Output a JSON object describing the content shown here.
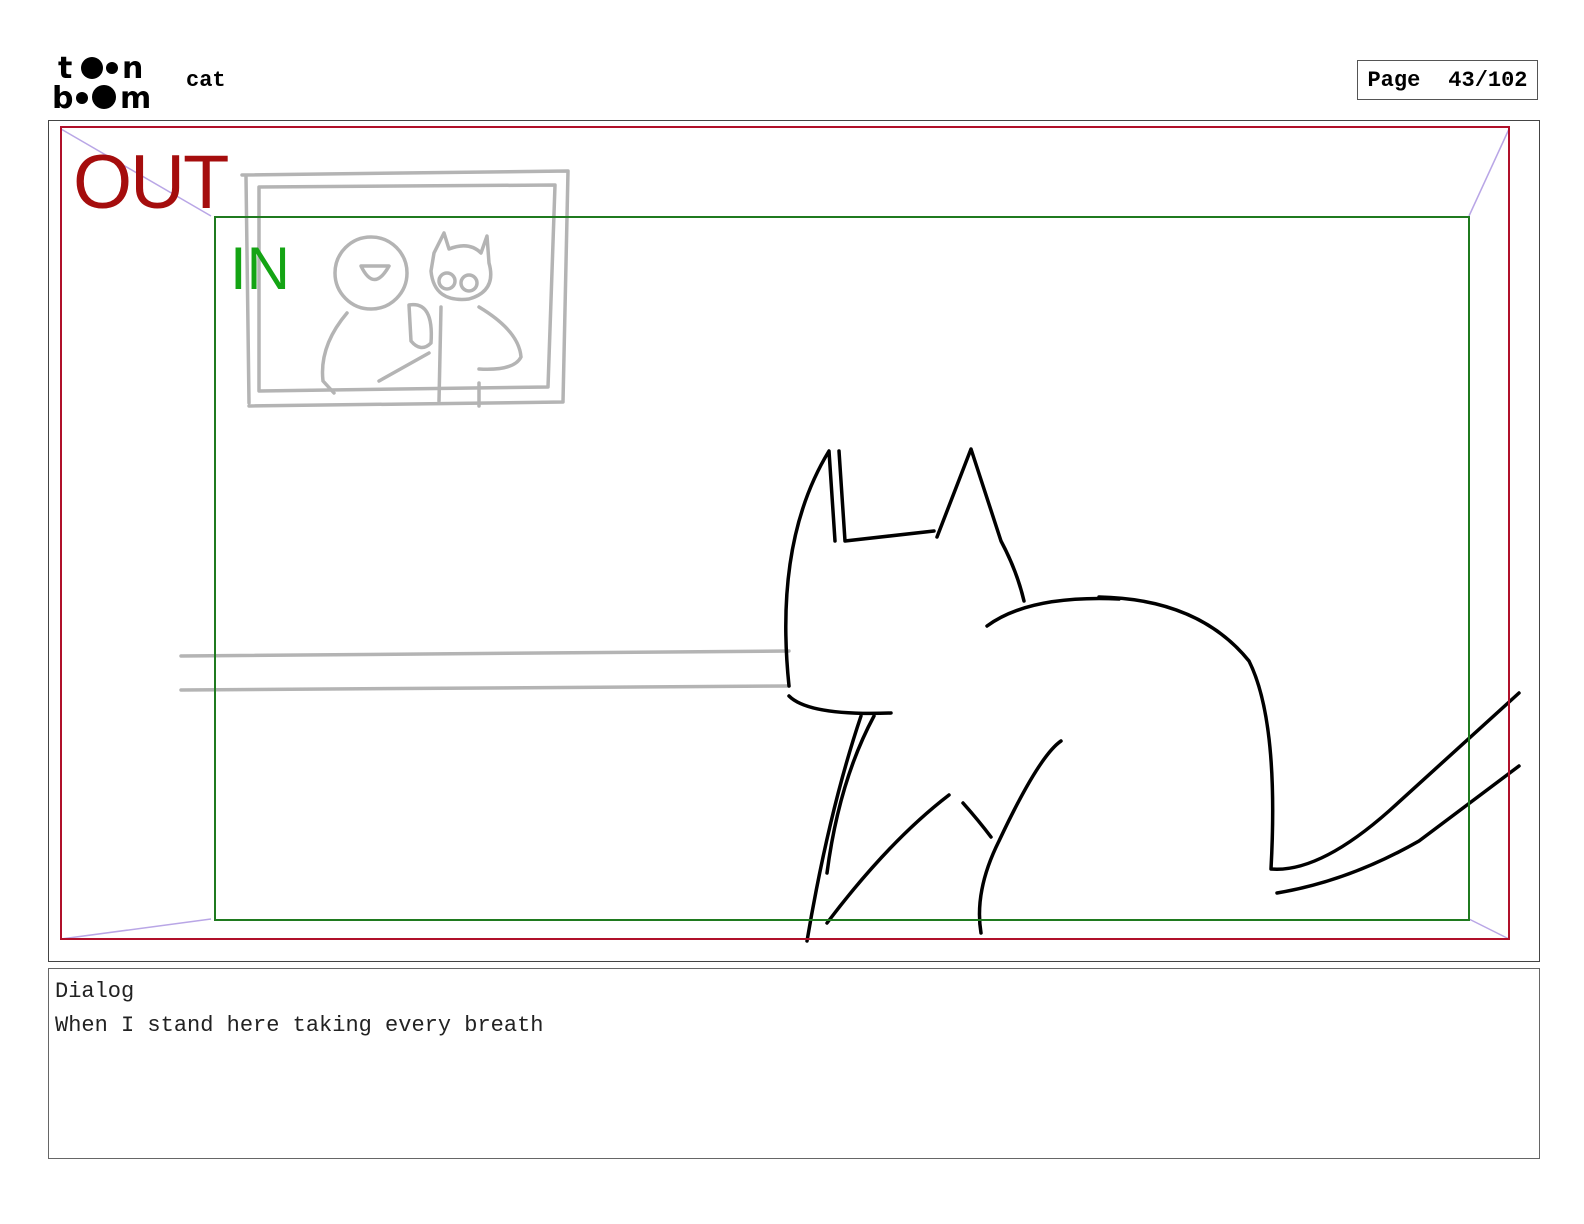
{
  "header": {
    "logo_text": [
      "toon",
      "boom"
    ],
    "project_name": "cat",
    "page_label": "Page",
    "page_number": "43/102"
  },
  "panel": {
    "out_label": "OUT",
    "in_label": "IN",
    "colors": {
      "out_frame": "#b0102a",
      "in_frame": "#1f7a1f",
      "out_label": "#a50d0d",
      "in_label": "#14a414",
      "sketch_gray": "#b4b4b4",
      "sketch_black": "#000000",
      "perspective": "#b9a6e6"
    }
  },
  "dialog": {
    "heading": "Dialog",
    "text": "When I stand here taking every breath"
  }
}
